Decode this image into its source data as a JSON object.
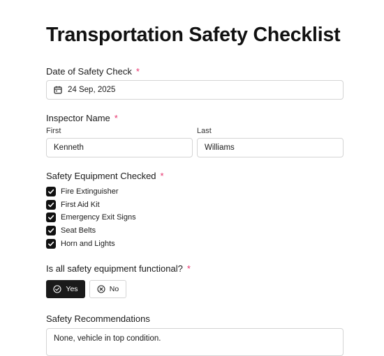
{
  "form": {
    "title": "Transportation Safety Checklist"
  },
  "date_field": {
    "label": "Date of Safety Check",
    "required_mark": "*",
    "icon": "calendar-icon",
    "value": "24 Sep, 2025"
  },
  "inspector": {
    "label": "Inspector Name",
    "required_mark": "*",
    "first_label": "First",
    "first_value": "Kenneth",
    "last_label": "Last",
    "last_value": "Williams"
  },
  "equipment": {
    "label": "Safety Equipment Checked",
    "required_mark": "*",
    "items": [
      {
        "label": "Fire Extinguisher",
        "checked": true
      },
      {
        "label": "First Aid Kit",
        "checked": true
      },
      {
        "label": "Emergency Exit Signs",
        "checked": true
      },
      {
        "label": "Seat Belts",
        "checked": true
      },
      {
        "label": "Horn and Lights",
        "checked": true
      }
    ]
  },
  "functional": {
    "label": "Is all safety equipment functional?",
    "required_mark": "*",
    "yes_label": "Yes",
    "no_label": "No",
    "selected": "Yes"
  },
  "recommendations": {
    "label": "Safety Recommendations",
    "value": "None, vehicle in top condition."
  },
  "colors": {
    "required": "#e8336d",
    "selected_button": "#1a1a1a",
    "border": "#d4d4d4"
  }
}
